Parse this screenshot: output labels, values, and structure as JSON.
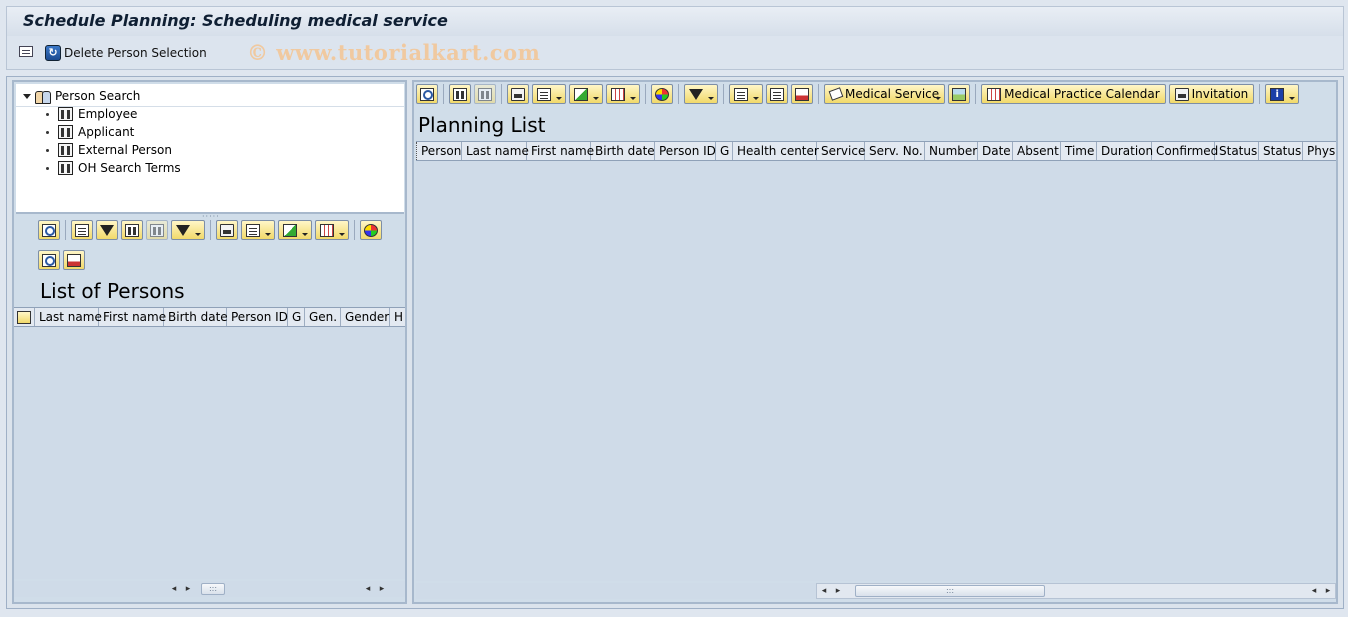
{
  "window": {
    "title": "Schedule Planning: Scheduling medical service",
    "watermark": "© www.tutorialkart.com"
  },
  "appbar": {
    "delete_person_selection_label": "Delete Person Selection"
  },
  "tree": {
    "root_label": "Person Search",
    "items": [
      {
        "label": "Employee"
      },
      {
        "label": "Applicant"
      },
      {
        "label": "External Person"
      },
      {
        "label": "OH Search Terms"
      }
    ]
  },
  "left_pane": {
    "title": "List of Persons",
    "columns": [
      "Last name",
      "First name",
      "Birth date",
      "Person ID",
      "G",
      "Gen.",
      "Gender",
      "H"
    ]
  },
  "right_pane": {
    "title": "Planning List",
    "toolbar": {
      "medical_service_label": "Medical Service",
      "medical_practice_calendar_label": "Medical Practice Calendar",
      "invitation_label": "Invitation"
    },
    "columns": [
      "Person",
      "Last name",
      "First name",
      "Birth date",
      "Person ID",
      "G",
      "Health center",
      "Service",
      "Serv. No.",
      "Number",
      "Date",
      "Absent",
      "Time",
      "Duration",
      "Confirmed",
      "Status",
      "Status",
      "Physi"
    ]
  },
  "icons": {
    "menu": "menu-icon",
    "delete_selection": "refresh-icon",
    "tree_root": "people-icon",
    "tree_item": "binoculars-icon"
  },
  "colors": {
    "title_text": "#0f1f33",
    "toolbar_button": "#f1d96a",
    "watermark": "#f0c9a0",
    "pane_background": "#d0dde9"
  }
}
